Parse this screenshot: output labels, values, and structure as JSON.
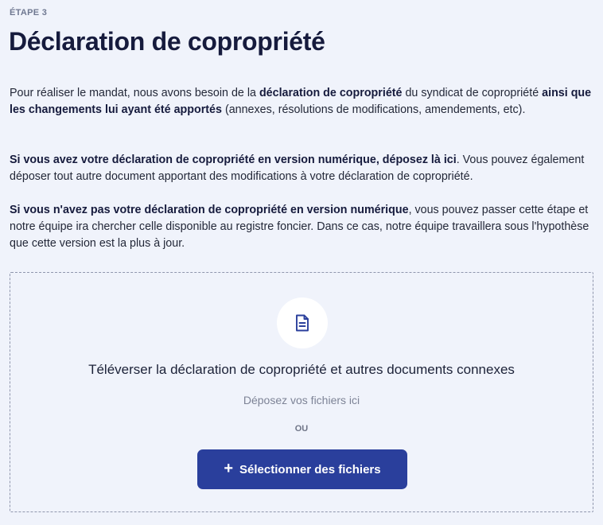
{
  "step": {
    "label": "ÉTAPE 3"
  },
  "title": "Déclaration de copropriété",
  "paragraphs": {
    "p1": {
      "a": "Pour réaliser le mandat, nous avons besoin de la ",
      "b": "déclaration de copropriété",
      "c": " du syndicat de copropriété ",
      "d": "ainsi que les changements lui ayant été apportés",
      "e": " (annexes, résolutions de modifications, amendements, etc)."
    },
    "p2": {
      "a": "Si vous avez votre déclaration de copropriété en version numérique, déposez là ici",
      "b": ". Vous pouvez également déposer tout autre document apportant des modifications à votre déclaration de copropriété."
    },
    "p3": {
      "a": "Si vous n'avez pas votre déclaration de copropriété en version numérique",
      "b": ", vous pouvez passer cette étape et notre équipe ira chercher celle disponible au registre foncier. Dans ce cas, notre équipe travaillera sous l'hypothèse que cette version est la plus à jour."
    }
  },
  "dropzone": {
    "icon": "document-icon",
    "title": "Téléverser la déclaration de copropriété et autres documents connexes",
    "hint": "Déposez vos fichiers ici",
    "or_label": "OU",
    "button_icon": "plus-icon",
    "button_label": "Sélectionner des fichiers"
  },
  "colors": {
    "background": "#f0f3fb",
    "title": "#161b3d",
    "button": "#2a3f9c",
    "icon": "#2a3f9c",
    "dashed_border": "#8f96ad"
  }
}
